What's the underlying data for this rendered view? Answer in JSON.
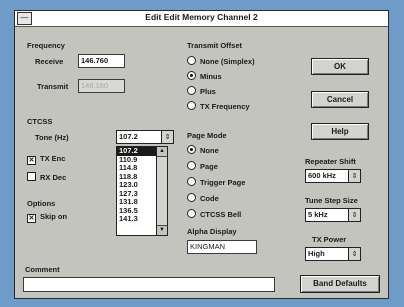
{
  "window": {
    "title": "Edit Edit Memory Channel 2",
    "sysmenu": "—"
  },
  "frequency": {
    "label": "Frequency",
    "receive_label": "Receive",
    "receive_value": "146.760",
    "transmit_label": "Transmit",
    "transmit_value": "146.160"
  },
  "ctcss": {
    "label": "CTCSS",
    "tone_label": "Tone (Hz)",
    "tone_value": "107.2",
    "tx_label": "TX Enc",
    "rx_label": "RX Dec",
    "tone_options": [
      "107.2",
      "110.9",
      "114.8",
      "118.8",
      "123.0",
      "127.3",
      "131.8",
      "136.5",
      "141.3"
    ]
  },
  "options": {
    "label": "Options",
    "skip_label": "Skip on"
  },
  "transmit_offset": {
    "label": "Transmit Offset",
    "options": [
      "None (Simplex)",
      "Minus",
      "Plus",
      "TX Frequency"
    ]
  },
  "page_mode": {
    "label": "Page Mode",
    "options": [
      "None",
      "Page",
      "Trigger Page",
      "Code",
      "CTCSS Bell"
    ]
  },
  "alpha_display": {
    "label": "Alpha Display",
    "value": "KINGMAN"
  },
  "buttons": {
    "ok": "OK",
    "cancel": "Cancel",
    "help": "Help",
    "band_defaults": "Band Defaults"
  },
  "repeater_shift": {
    "label": "Repeater Shift",
    "value": "600 kHz"
  },
  "tune_step": {
    "label": "Tune Step Size",
    "value": "5 kHz"
  },
  "tx_power": {
    "label": "TX Power",
    "value": "High"
  },
  "comment": {
    "label": "Comment",
    "value": ""
  }
}
